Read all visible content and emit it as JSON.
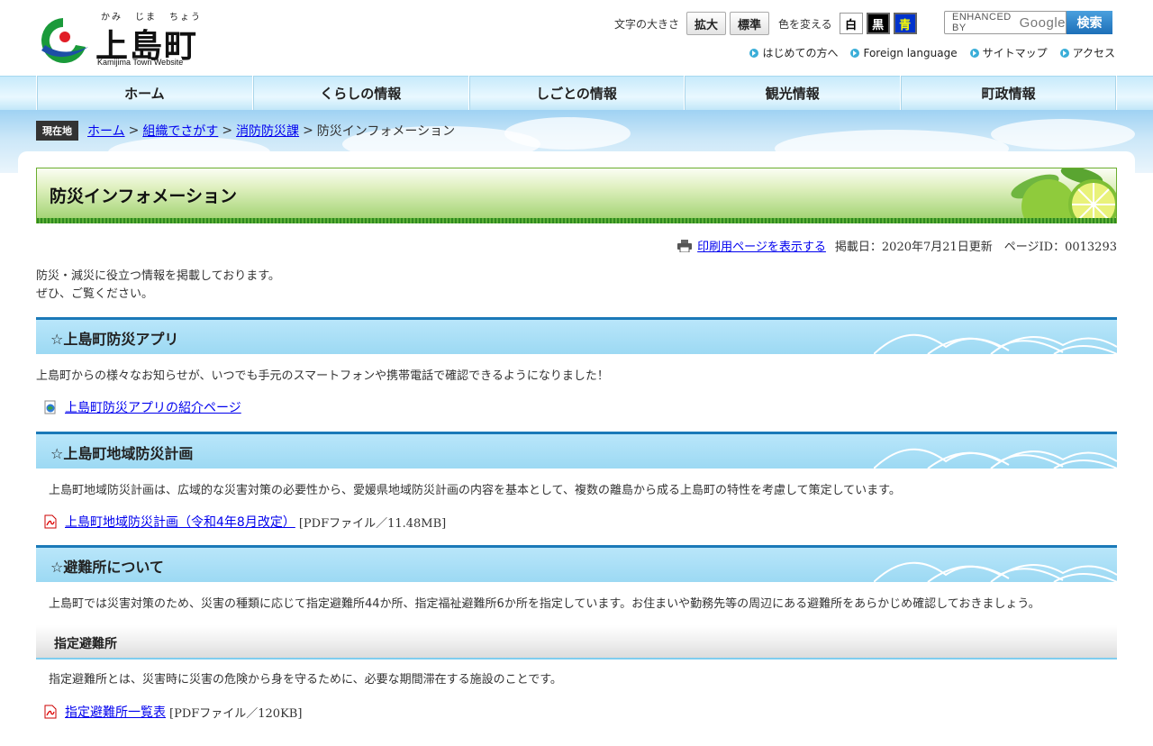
{
  "header": {
    "logo_ruby": [
      "かみ",
      "じま",
      "ちょう"
    ],
    "logo_name": "上島町",
    "logo_sub": "Kamijima Town Website",
    "font_size_label": "文字の大きさ",
    "font_size_buttons": [
      "拡大",
      "標準"
    ],
    "color_label": "色を変える",
    "color_buttons": [
      "白",
      "黒",
      "青"
    ],
    "search_placeholder": "ENHANCED BY",
    "search_brand": "Google",
    "search_button": "検索",
    "sub_links": [
      "はじめての方へ",
      "Foreign language",
      "サイトマップ",
      "アクセス"
    ]
  },
  "nav": [
    "ホーム",
    "くらしの情報",
    "しごとの情報",
    "観光情報",
    "町政情報"
  ],
  "breadcrumb": {
    "tag": "現在地",
    "items": [
      "ホーム",
      "組織でさがす",
      "消防防災課"
    ],
    "current": "防災インフォメーション"
  },
  "page": {
    "title": "防災インフォメーション",
    "print_link": "印刷用ページを表示する",
    "meta": "掲載日：2020年7月21日更新　ページID：0013293",
    "intro": [
      "防災・減災に役立つ情報を掲載しております。",
      "ぜひ、ご覧ください。"
    ]
  },
  "sections": [
    {
      "heading": "☆上島町防災アプリ",
      "text": "上島町からの様々なお知らせが、いつでも手元のスマートフォンや携帯電話で確認できるようになりました！",
      "link": "上島町防災アプリの紹介ページ",
      "note": ""
    },
    {
      "heading": "☆上島町地域防災計画",
      "text": "上島町地域防災計画は、広域的な災害対策の必要性から、愛媛県地域防災計画の内容を基本として、複数の離島から成る上島町の特性を考慮して策定しています。",
      "link": "上島町地域防災計画（令和4年8月改定）",
      "note": "[PDFファイル／11.48MB]"
    },
    {
      "heading": "☆避難所について",
      "text": "上島町では災害対策のため、災害の種類に応じて指定避難所44か所、指定福祉避難所6か所を指定しています。お住まいや勤務先等の周辺にある避難所をあらかじめ確認しておきましょう。"
    }
  ],
  "subsection": {
    "heading": "指定避難所",
    "text": "指定避難所とは、災害時に災害の危険から身を守るために、必要な期間滞在する施設のことです。",
    "link": "指定避難所一覧表",
    "note": "[PDFファイル／120KB]"
  }
}
